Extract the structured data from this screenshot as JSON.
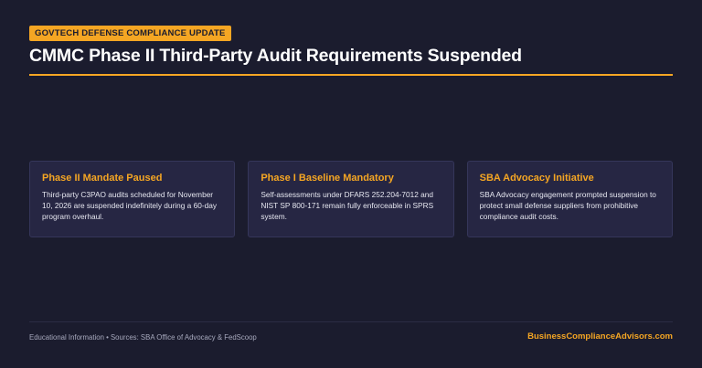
{
  "header": {
    "badge": "GOVTECH DEFENSE COMPLIANCE UPDATE",
    "title": "CMMC Phase II Third-Party Audit Requirements Suspended"
  },
  "cards": [
    {
      "title": "Phase II Mandate Paused",
      "body": "Third-party C3PAO audits scheduled for November 10, 2026 are suspended indefinitely during a 60-day program overhaul."
    },
    {
      "title": "Phase I Baseline Mandatory",
      "body": "Self-assessments under DFARS 252.204-7012 and NIST SP 800-171 remain fully enforceable in SPRS system."
    },
    {
      "title": "SBA Advocacy Initiative",
      "body": "SBA Advocacy engagement prompted suspension to protect small defense suppliers from prohibitive compliance audit costs."
    }
  ],
  "footer": {
    "sources": "Educational Information • Sources: SBA Office of Advocacy & FedScoop",
    "brand": "BusinessComplianceAdvisors.com"
  },
  "colors": {
    "background": "#1b1c2e",
    "accent": "#f5a623",
    "card": "#262643"
  }
}
